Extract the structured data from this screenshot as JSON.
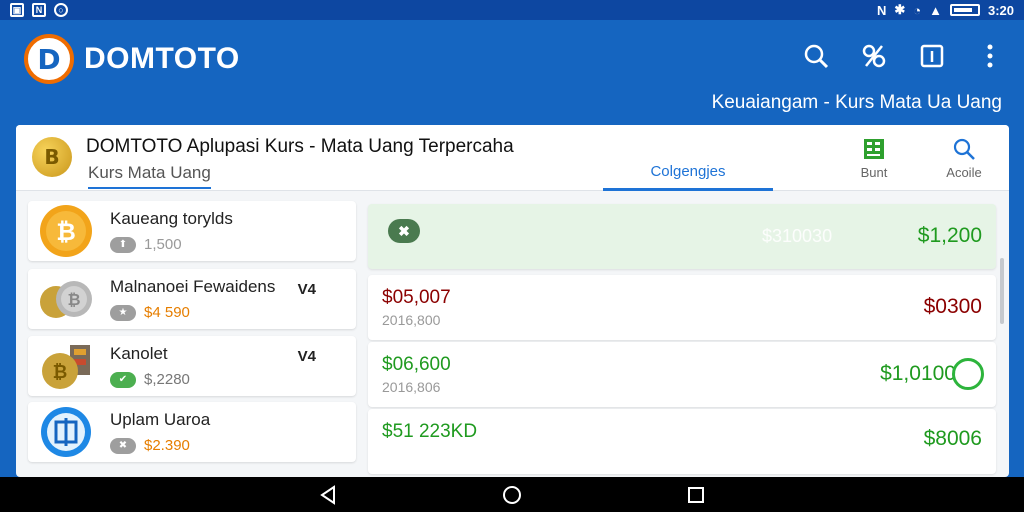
{
  "statusbar": {
    "time": "3:20"
  },
  "appbar": {
    "brand": "DOMTOTO",
    "logo_letter": "D",
    "subtitle": "Keuaiangam - Kurs Mata Ua Uang",
    "actions": [
      "search-icon",
      "discount-icon",
      "info-icon",
      "more-icon"
    ]
  },
  "card": {
    "title": "DOMTOTO Aplupasi Kurs - Mata Uang Terpercaha",
    "subtitle": "Kurs Mata Uang",
    "coin_letter": "B",
    "tab_active": "Colgengjes",
    "buttons": [
      {
        "label": "Bunt",
        "icon": "grid-icon"
      },
      {
        "label": "Acoile",
        "icon": "search-icon"
      }
    ]
  },
  "list": [
    {
      "name": "Kaueang torylds",
      "tag": "",
      "pill": "up",
      "value": "1,500"
    },
    {
      "name": "Malnanoei Fewaidens",
      "tag": "V4",
      "pill": "star",
      "value": "$4 590"
    },
    {
      "name": "Kanolet",
      "tag": "V4",
      "pill": "check",
      "value": "$,2280"
    },
    {
      "name": "Uplam Uaroa",
      "tag": "",
      "pill": "x",
      "value": "$2.390"
    }
  ],
  "rows": [
    {
      "primary": "",
      "secondary": "",
      "faint": "$310030",
      "value": "$1,200"
    },
    {
      "primary": "$05,007",
      "secondary": "2016,800",
      "faint": "",
      "value": "$0300"
    },
    {
      "primary": "$06,600",
      "secondary": "2016,806",
      "faint": "",
      "value": "$1,0100"
    },
    {
      "primary": "$51 223KD",
      "secondary": "",
      "faint": "",
      "value": "$8006"
    }
  ],
  "colors": {
    "primary": "#1565c0",
    "accent": "#1e73d6",
    "positive": "#1f9a1f",
    "negative": "#8b0000"
  }
}
